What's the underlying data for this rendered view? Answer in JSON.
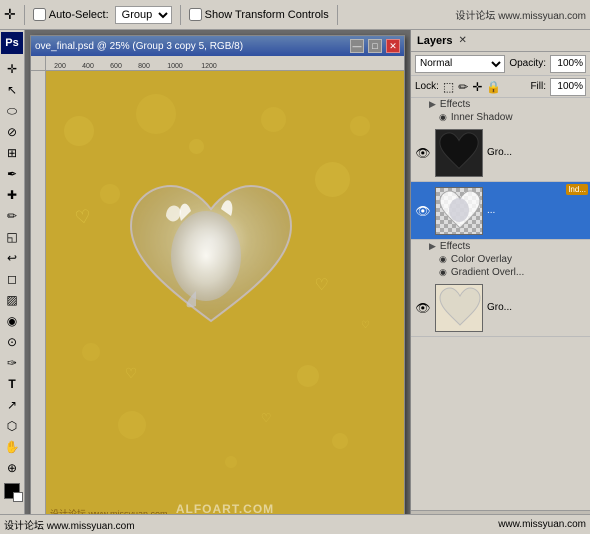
{
  "toolbar": {
    "move_tool": "✛",
    "auto_select_label": "Auto-Select:",
    "group_label": "Group",
    "show_transform_label": "Show Transform Controls",
    "site_top": "设计论坛 www.missyuan.com"
  },
  "canvas_window": {
    "title": "ove_final.psd @ 25% (Group 3 copy 5, RGB/8)",
    "min_btn": "—",
    "max_btn": "□",
    "close_btn": "✕"
  },
  "ruler": {
    "marks": [
      "200",
      "400",
      "600",
      "800",
      "1000",
      "1200"
    ]
  },
  "layers_panel": {
    "tab_label": "Layers",
    "tab_close": "✕",
    "blend_mode": "Normal",
    "opacity_label": "Opacity:",
    "opacity_value": "100%",
    "lock_label": "Lock:",
    "fill_label": "Fill:",
    "fill_value": "100%",
    "layers": [
      {
        "id": "effects-group-label",
        "type": "effect-label",
        "indent": 1,
        "text": "Effects"
      },
      {
        "id": "inner-shadow-label",
        "type": "effect-label",
        "indent": 2,
        "text": "Inner Shadow"
      },
      {
        "id": "dark-heart-layer",
        "type": "layer",
        "visible": true,
        "name": "Gro...",
        "selected": false,
        "has_effects": false,
        "thumb_type": "dark-heart"
      },
      {
        "id": "selected-layer",
        "type": "layer",
        "visible": true,
        "name": "...",
        "selected": true,
        "has_effects": true,
        "fx_label": "Ind...",
        "thumb_type": "checker-heart"
      },
      {
        "id": "effects-label-2",
        "type": "effect-label",
        "indent": 1,
        "text": "Effects"
      },
      {
        "id": "color-overlay-label",
        "type": "effect-label",
        "indent": 2,
        "text": "Color Overlay"
      },
      {
        "id": "gradient-overlay-label",
        "type": "effect-label",
        "indent": 2,
        "text": "Gradient Overl..."
      },
      {
        "id": "light-heart-layer",
        "type": "layer",
        "visible": true,
        "name": "Gro...",
        "selected": false,
        "has_effects": false,
        "thumb_type": "light-heart"
      }
    ],
    "bottom_buttons": [
      "link",
      "fx",
      "mask",
      "folder",
      "new",
      "trash"
    ]
  },
  "status_bar": {
    "left_text": "设计论坛 www.missyuan.com",
    "right_text": "www.missyuan.com"
  },
  "tools": [
    "✛",
    "↖",
    "▭",
    "✂",
    "⊘",
    "∞",
    "✏",
    "◈",
    "▨",
    "✒",
    "✑",
    "T",
    "↗",
    "◻",
    "⬡",
    "⊕",
    "◉",
    "▼"
  ]
}
